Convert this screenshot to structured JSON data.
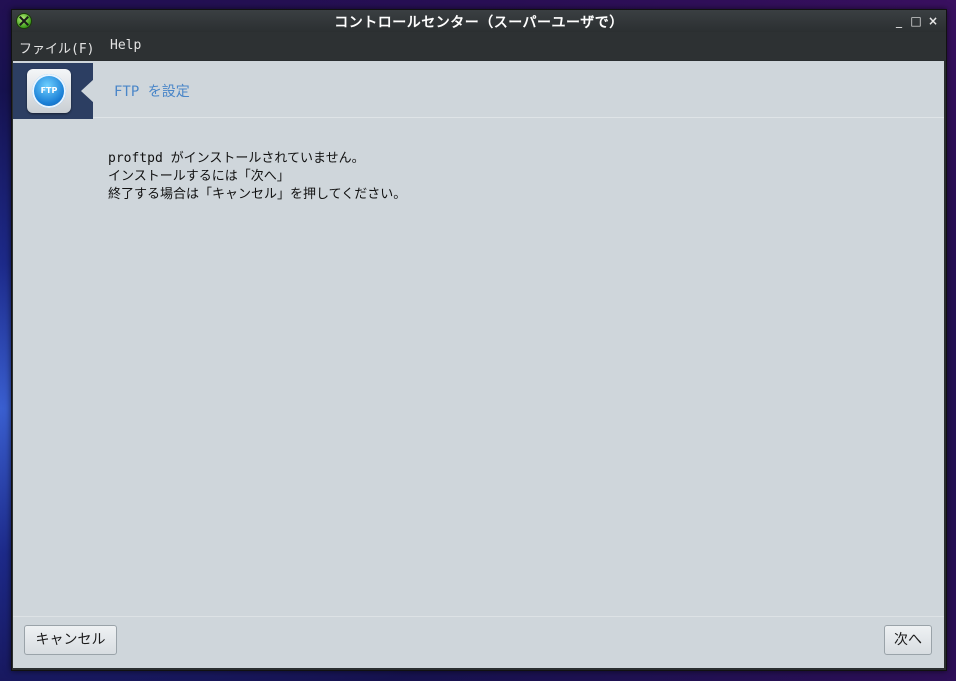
{
  "window": {
    "title": "コントロールセンター（スーパーユーザで）",
    "controls": {
      "minimize": "_",
      "maximize": "□",
      "close": "×"
    }
  },
  "menubar": {
    "file": "ファイル(F)",
    "help": "Help"
  },
  "header": {
    "icon_label": "FTP",
    "title": "FTP を設定"
  },
  "message": {
    "lines": [
      "proftpd がインストールされていません。",
      "インストールするには「次へ」",
      "終了する場合は「キャンセル」を押してください。"
    ]
  },
  "buttons": {
    "cancel": "キャンセル",
    "next": "次へ"
  },
  "colors": {
    "content_bg": "#cfd6db",
    "header_title": "#4a86c8",
    "icon_box": "#2c3e62",
    "titlebar": "#2b2f31"
  },
  "icons": {
    "app": "mageia-x-icon",
    "header": "ftp-icon"
  }
}
